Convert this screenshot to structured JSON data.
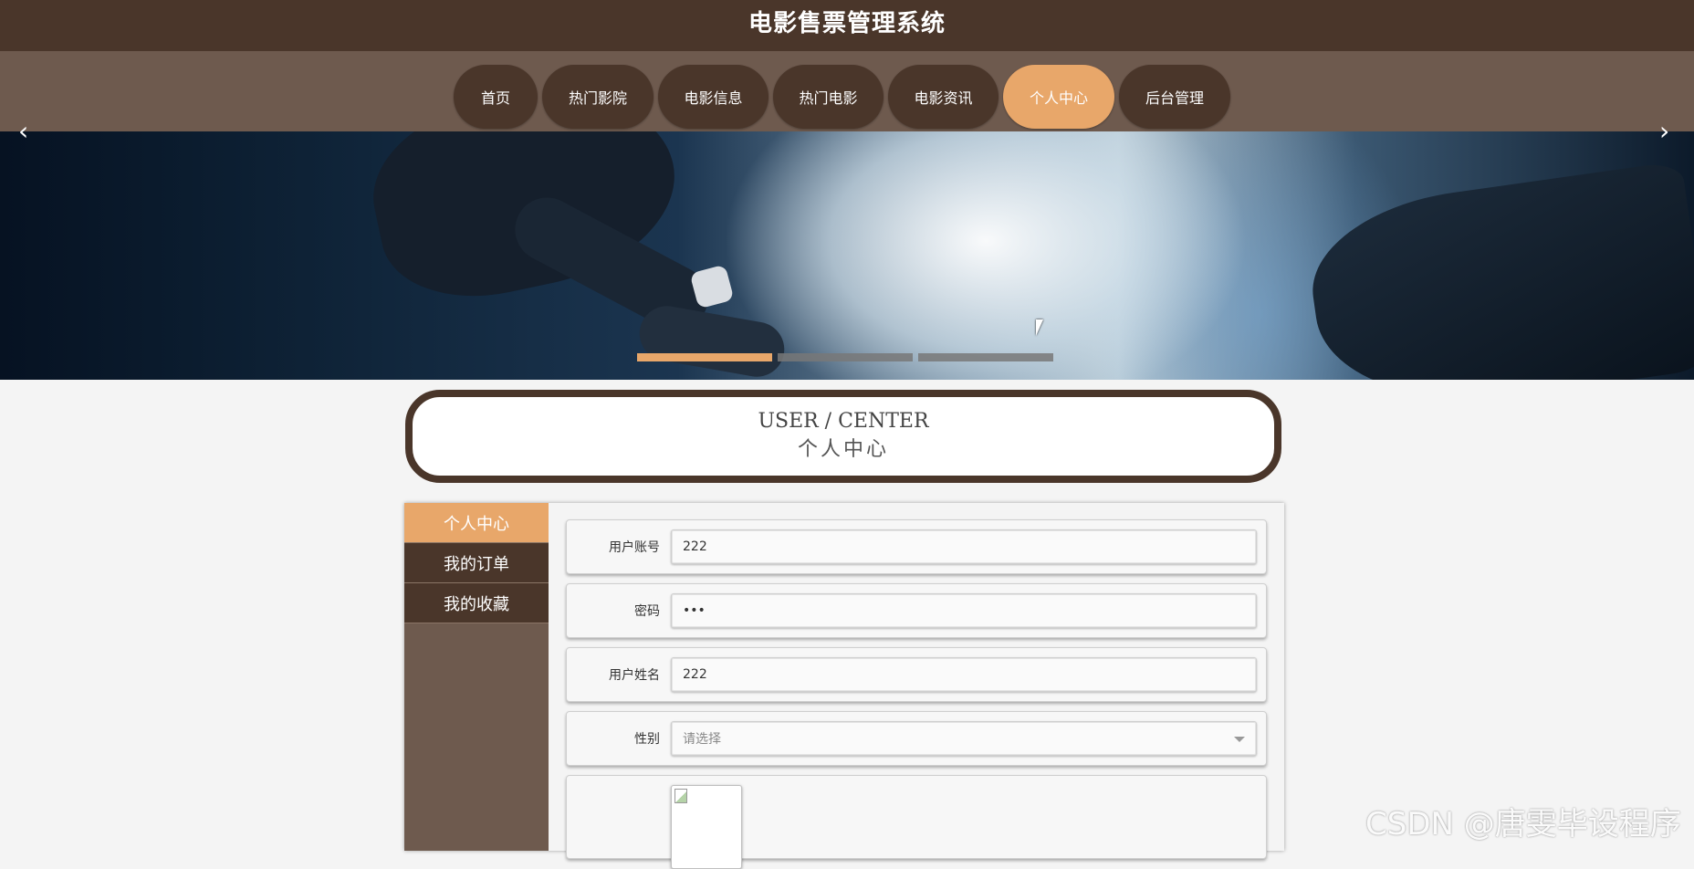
{
  "header": {
    "site_title": "电影售票管理系统"
  },
  "nav": {
    "items": [
      {
        "label": "首页"
      },
      {
        "label": "热门影院"
      },
      {
        "label": "电影信息"
      },
      {
        "label": "热门电影"
      },
      {
        "label": "电影资讯"
      },
      {
        "label": "个人中心",
        "active": true
      },
      {
        "label": "后台管理"
      }
    ]
  },
  "carousel": {
    "prev_glyph": "‹",
    "next_glyph": "›",
    "slide_count": 3,
    "active_index": 0
  },
  "section": {
    "title_en": "USER / CENTER",
    "title_zh": "个人中心"
  },
  "side_menu": {
    "items": [
      {
        "label": "个人中心",
        "active": true
      },
      {
        "label": "我的订单"
      },
      {
        "label": "我的收藏"
      }
    ]
  },
  "form": {
    "account_label": "用户账号",
    "account_value": "222",
    "password_label": "密码",
    "password_value": "•••",
    "name_label": "用户姓名",
    "name_value": "222",
    "gender_label": "性别",
    "gender_placeholder": "请选择"
  },
  "watermark": "CSDN @唐雯毕设程序",
  "colors": {
    "header_bg": "#4a362a",
    "nav_bg": "#6e5a4e",
    "accent": "#e8a76a"
  }
}
